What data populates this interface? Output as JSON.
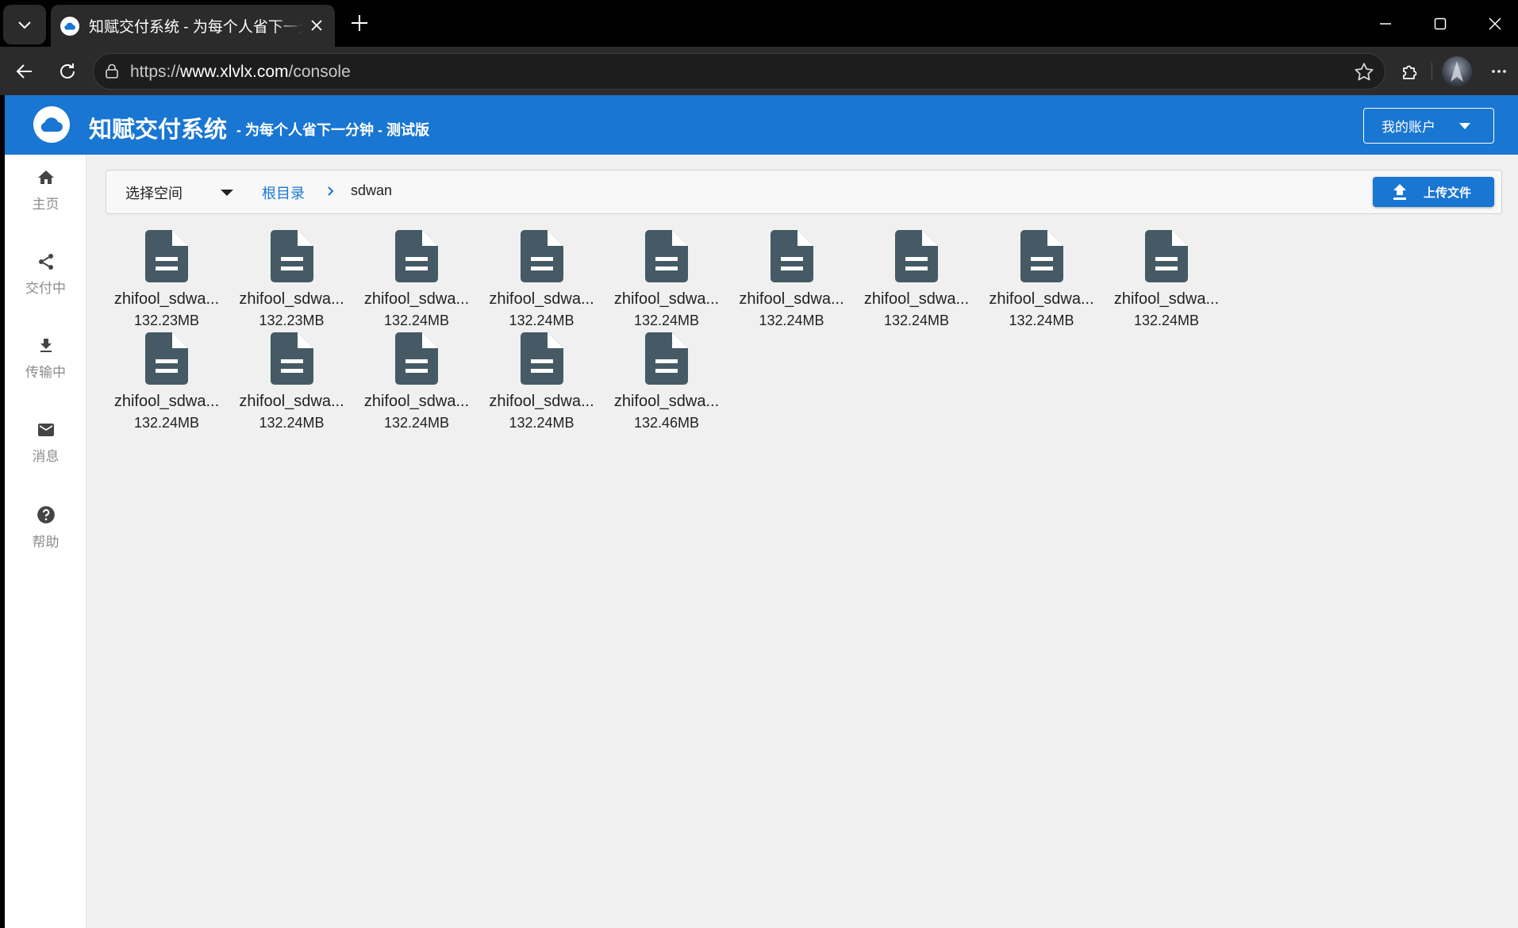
{
  "browser": {
    "tab_title": "知赋交付系统 - 为每个人省下一分钟 - 测试版",
    "url_prefix": "https://",
    "url_host": "www.xlvlx.com",
    "url_path": "/console"
  },
  "header": {
    "brand": "知赋交付系统",
    "subtitle": "- 为每个人省下一分钟 - 测试版",
    "account_label": "我的账户"
  },
  "sidebar": {
    "items": [
      {
        "label": "主页",
        "icon": "home-icon"
      },
      {
        "label": "交付中",
        "icon": "share-icon"
      },
      {
        "label": "传输中",
        "icon": "download-icon"
      },
      {
        "label": "消息",
        "icon": "mail-icon"
      },
      {
        "label": "帮助",
        "icon": "help-icon"
      }
    ]
  },
  "pathbar": {
    "space_select": "选择空间",
    "root": "根目录",
    "current": "sdwan",
    "upload_label": "上传文件"
  },
  "files": [
    {
      "name": "zhifool_sdwa...",
      "size": "132.23MB"
    },
    {
      "name": "zhifool_sdwa...",
      "size": "132.23MB"
    },
    {
      "name": "zhifool_sdwa...",
      "size": "132.24MB"
    },
    {
      "name": "zhifool_sdwa...",
      "size": "132.24MB"
    },
    {
      "name": "zhifool_sdwa...",
      "size": "132.24MB"
    },
    {
      "name": "zhifool_sdwa...",
      "size": "132.24MB"
    },
    {
      "name": "zhifool_sdwa...",
      "size": "132.24MB"
    },
    {
      "name": "zhifool_sdwa...",
      "size": "132.24MB"
    },
    {
      "name": "zhifool_sdwa...",
      "size": "132.24MB"
    },
    {
      "name": "zhifool_sdwa...",
      "size": "132.24MB"
    },
    {
      "name": "zhifool_sdwa...",
      "size": "132.24MB"
    },
    {
      "name": "zhifool_sdwa...",
      "size": "132.24MB"
    },
    {
      "name": "zhifool_sdwa...",
      "size": "132.24MB"
    },
    {
      "name": "zhifool_sdwa...",
      "size": "132.46MB"
    }
  ],
  "colors": {
    "primary": "#1976d2",
    "file_icon": "#455a64"
  }
}
